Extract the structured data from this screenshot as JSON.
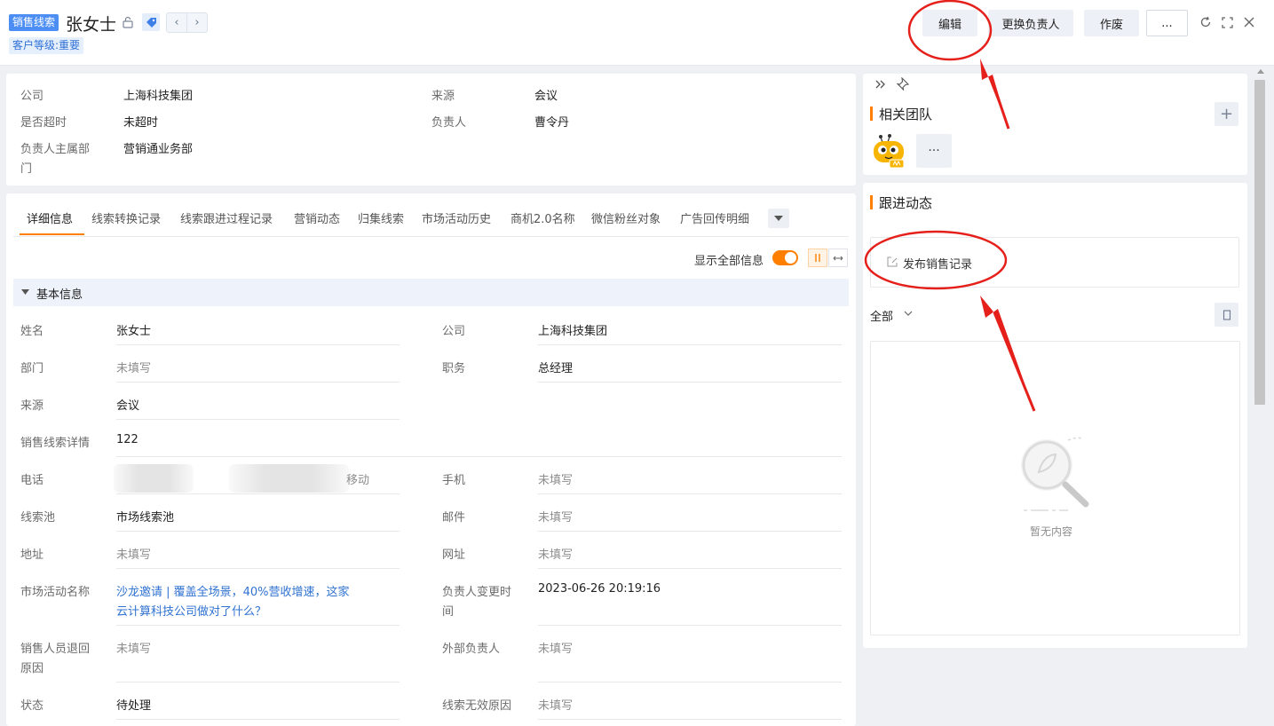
{
  "header": {
    "type_tag": "销售线索",
    "title": "张女士",
    "level_tag": "客户等级:重要",
    "nav_prev": "‹",
    "nav_next": "›",
    "buttons": {
      "edit": "编辑",
      "change_owner": "更换负责人",
      "void": "作废",
      "more": "..."
    }
  },
  "summary": {
    "company_label": "公司",
    "company_value": "上海科技集团",
    "source_label": "来源",
    "source_value": "会议",
    "overtime_label": "是否超时",
    "overtime_value": "未超时",
    "owner_label": "负责人",
    "owner_value": "曹令丹",
    "dept_label_1": "负责人主属部",
    "dept_label_2": "门",
    "dept_value": "营销通业务部"
  },
  "tabs": [
    "详细信息",
    "线索转换记录",
    "线索跟进过程记录",
    "营销动态",
    "归集线索",
    "市场活动历史",
    "商机2.0名称",
    "微信粉丝对象",
    "广告回传明细"
  ],
  "toolbar": {
    "show_all_label": "显示全部信息",
    "show_all_on": true
  },
  "section": {
    "title": "基本信息"
  },
  "fields": {
    "name_label": "姓名",
    "name_value": "张女士",
    "company_label": "公司",
    "company_value": "上海科技集团",
    "dept_label": "部门",
    "dept_value": "未填写",
    "position_label": "职务",
    "position_value": "总经理",
    "source_label": "来源",
    "source_value": "会议",
    "detail_label": "销售线索详情",
    "detail_value": "122",
    "phone_label": "电话",
    "phone_suffix": "移动",
    "mobile_label": "手机",
    "mobile_value": "未填写",
    "pool_label": "线索池",
    "pool_value": "市场线索池",
    "email_label": "邮件",
    "email_value": "未填写",
    "address_label": "地址",
    "address_value": "未填写",
    "website_label": "网址",
    "website_value": "未填写",
    "campaign_label": "市场活动名称",
    "campaign_value_1": "沙龙邀请 | 覆盖全场景，40%营收增速，这家",
    "campaign_value_2": "云计算科技公司做对了什么？",
    "owner_change_label_1": "负责人变更时",
    "owner_change_label_2": "间",
    "owner_change_value": "2023-06-26 20:19:16",
    "return_reason_label_1": "销售人员退回",
    "return_reason_label_2": "原因",
    "return_reason_value": "未填写",
    "external_owner_label": "外部负责人",
    "external_owner_value": "未填写",
    "status_label": "状态",
    "status_value": "待处理",
    "invalid_reason_label": "线索无效原因",
    "invalid_reason_value": "未填写"
  },
  "right": {
    "team_title": "相关团队",
    "team_more": "···",
    "follow_title": "跟进动态",
    "publish_label": "发布销售记录",
    "filter_label": "全部",
    "empty_text": "暂无内容"
  },
  "colors": {
    "accent": "#ff8000",
    "primary": "#4d8ef5",
    "link": "#2f72d1",
    "annotation": "#e5201b"
  }
}
